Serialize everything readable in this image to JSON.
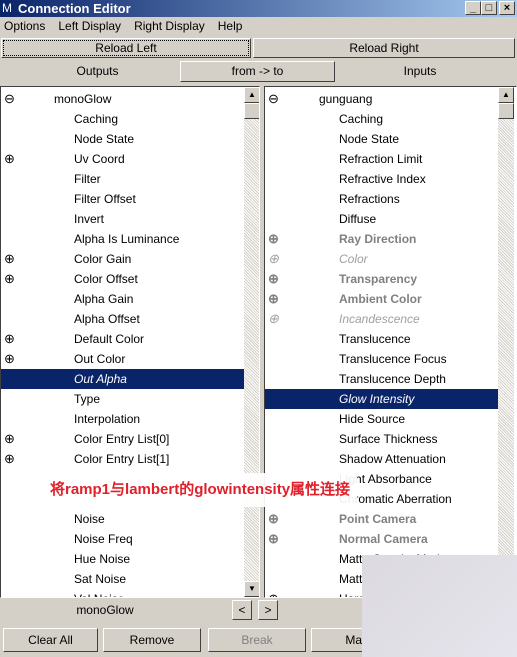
{
  "window": {
    "title": "Connection Editor",
    "logo": "M"
  },
  "menu": [
    "Options",
    "Left Display",
    "Right Display",
    "Help"
  ],
  "toolbar": {
    "reload_left": "Reload Left",
    "reload_right": "Reload Right",
    "outputs": "Outputs",
    "direction": "from -> to",
    "inputs": "Inputs"
  },
  "left": {
    "node": "monoGlow",
    "items": [
      {
        "label": "Caching"
      },
      {
        "label": "Node State"
      },
      {
        "label": "Uv Coord",
        "expand": true
      },
      {
        "label": "Filter"
      },
      {
        "label": "Filter Offset"
      },
      {
        "label": "Invert"
      },
      {
        "label": "Alpha Is Luminance"
      },
      {
        "label": "Color Gain",
        "expand": true
      },
      {
        "label": "Color Offset",
        "expand": true
      },
      {
        "label": "Alpha Gain"
      },
      {
        "label": "Alpha Offset"
      },
      {
        "label": "Default Color",
        "expand": true
      },
      {
        "label": "Out Color",
        "expand": true
      },
      {
        "label": "Out Alpha",
        "selected": true
      },
      {
        "label": "Type"
      },
      {
        "label": "Interpolation"
      },
      {
        "label": "Color Entry List[0]",
        "expand": true
      },
      {
        "label": "Color Entry List[1]",
        "expand": true
      },
      {
        "label": ""
      },
      {
        "label": ""
      },
      {
        "label": "Noise"
      },
      {
        "label": "Noise Freq"
      },
      {
        "label": "Hue Noise"
      },
      {
        "label": "Sat Noise"
      },
      {
        "label": "Val Noise"
      }
    ]
  },
  "right": {
    "node": "gunguang",
    "items": [
      {
        "label": "Caching"
      },
      {
        "label": "Node State"
      },
      {
        "label": "Refraction Limit"
      },
      {
        "label": "Refractive Index"
      },
      {
        "label": "Refractions"
      },
      {
        "label": "Diffuse"
      },
      {
        "label": "Ray Direction",
        "expand": true,
        "style": "bold"
      },
      {
        "label": "Color",
        "expand": true,
        "style": "ital"
      },
      {
        "label": "Transparency",
        "expand": true,
        "style": "bold"
      },
      {
        "label": "Ambient Color",
        "expand": true,
        "style": "bold"
      },
      {
        "label": "Incandescence",
        "expand": true,
        "style": "ital"
      },
      {
        "label": "Translucence"
      },
      {
        "label": "Translucence Focus"
      },
      {
        "label": "Translucence Depth"
      },
      {
        "label": "Glow Intensity",
        "selected": true
      },
      {
        "label": "Hide Source"
      },
      {
        "label": "Surface Thickness"
      },
      {
        "label": "Shadow Attenuation"
      },
      {
        "label": "Light Absorbance"
      },
      {
        "label": "Chromatic Aberration"
      },
      {
        "label": "Point Camera",
        "expand": true,
        "style": "bold"
      },
      {
        "label": "Normal Camera",
        "expand": true,
        "style": "bold"
      },
      {
        "label": "Matte Opacity Mode"
      },
      {
        "label": "Matte Opacity"
      },
      {
        "label": "Hardware Shader",
        "expand": true
      }
    ]
  },
  "footer": {
    "node": "monoGlow",
    "prev": "<",
    "next": ">"
  },
  "buttons": {
    "clear_all": "Clear All",
    "remove": "Remove",
    "break": "Break",
    "make": "Make"
  },
  "annotation": "将ramp1与lambert的glowintensity属性连接",
  "colors": {
    "selection": "#0a246a",
    "annotation": "#e0202a"
  }
}
